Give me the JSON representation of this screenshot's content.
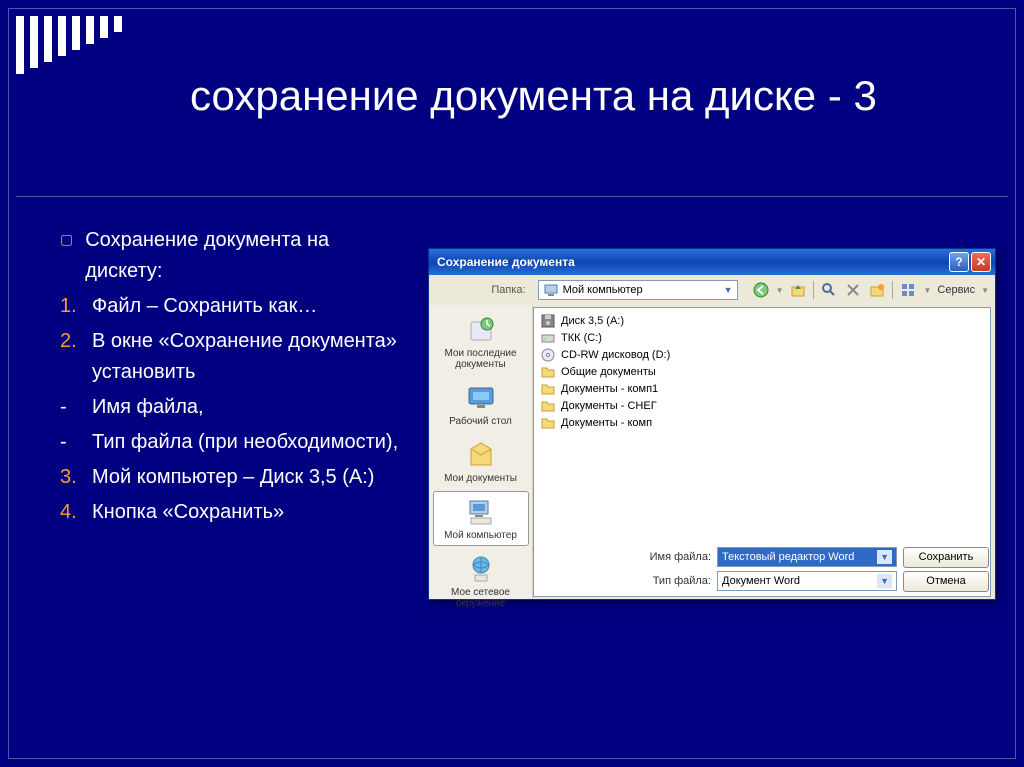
{
  "slide": {
    "title": "сохранение документа на диске - 3",
    "bullet_intro": "Сохранение документа на дискету:",
    "steps": [
      {
        "num": "1.",
        "text": "Файл – Сохранить как…"
      },
      {
        "num": "2.",
        "text": "В окне «Сохранение документа» установить"
      },
      {
        "num": "-",
        "text": "Имя файла,"
      },
      {
        "num": "-",
        "text": "Тип файла (при необходимости),"
      },
      {
        "num": "3.",
        "text": "Мой компьютер – Диск 3,5 (A:)"
      },
      {
        "num": "4.",
        "text": "Кнопка «Сохранить»"
      }
    ]
  },
  "dialog": {
    "title": "Сохранение документа",
    "folder_label": "Папка:",
    "folder_value": "Мой компьютер",
    "tools_label": "Сервис",
    "sidebar": [
      {
        "label": "Мои последние документы",
        "icon": "recent"
      },
      {
        "label": "Рабочий стол",
        "icon": "desktop"
      },
      {
        "label": "Мои документы",
        "icon": "mydocs"
      },
      {
        "label": "Мой компьютер",
        "icon": "mycomputer",
        "selected": true
      },
      {
        "label": "Мое сетевое окружение",
        "icon": "network"
      }
    ],
    "files": [
      {
        "icon": "floppy",
        "label": "Диск 3,5 (A:)"
      },
      {
        "icon": "hdd",
        "label": "ТКК (C:)"
      },
      {
        "icon": "cd",
        "label": "CD-RW дисковод (D:)"
      },
      {
        "icon": "folder",
        "label": "Общие документы"
      },
      {
        "icon": "folder",
        "label": "Документы - комп1"
      },
      {
        "icon": "folder",
        "label": "Документы - СНЕГ"
      },
      {
        "icon": "folder",
        "label": "Документы - комп"
      }
    ],
    "filename_label": "Имя файла:",
    "filename_value": "Текстовый редактор Word",
    "filetype_label": "Тип файла:",
    "filetype_value": "Документ Word",
    "save_btn": "Сохранить",
    "cancel_btn": "Отмена"
  }
}
